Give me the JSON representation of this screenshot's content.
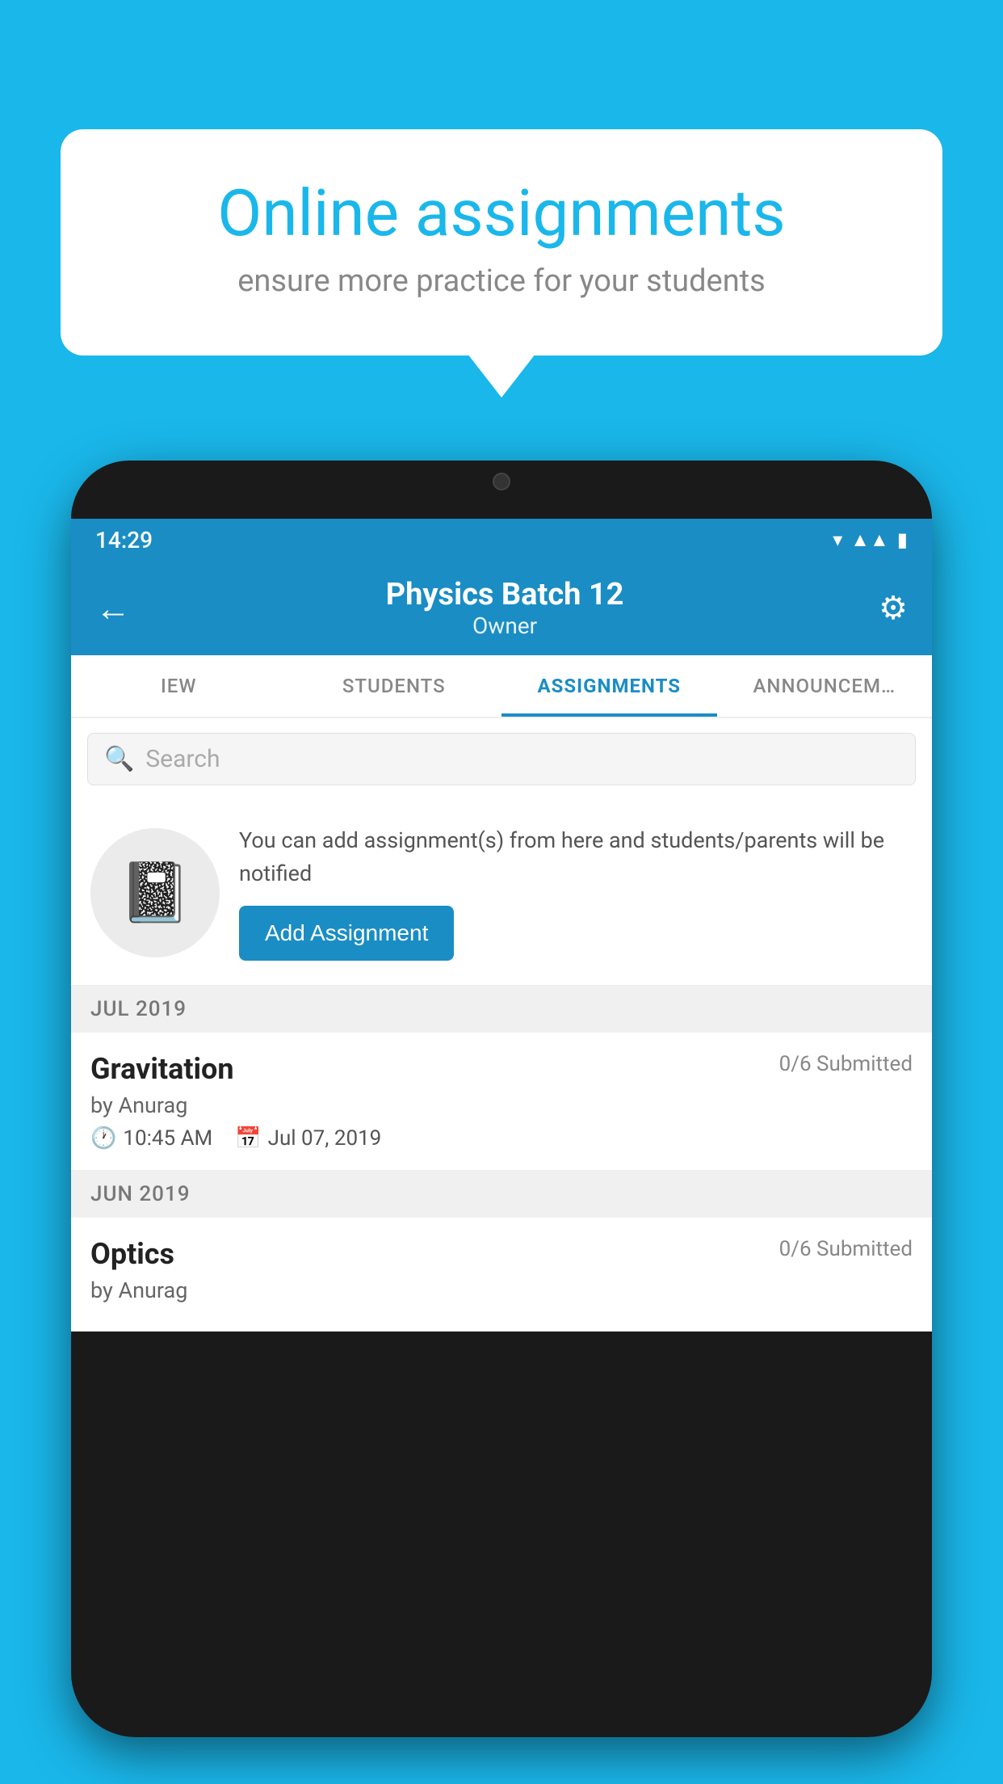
{
  "background_color": "#1ab7ea",
  "speech_bubble": {
    "title": "Online assignments",
    "subtitle": "ensure more practice for your students"
  },
  "phone": {
    "status_bar": {
      "time": "14:29",
      "icons": [
        "wifi",
        "signal",
        "battery"
      ]
    },
    "header": {
      "title": "Physics Batch 12",
      "subtitle": "Owner",
      "back_label": "←",
      "settings_label": "⚙"
    },
    "tabs": [
      {
        "label": "IEW",
        "active": false
      },
      {
        "label": "STUDENTS",
        "active": false
      },
      {
        "label": "ASSIGNMENTS",
        "active": true
      },
      {
        "label": "ANNOUNCEMENTS",
        "active": false
      }
    ],
    "search": {
      "placeholder": "Search"
    },
    "promo": {
      "text": "You can add assignment(s) from here and students/parents will be notified",
      "button_label": "Add Assignment"
    },
    "sections": [
      {
        "header": "JUL 2019",
        "assignments": [
          {
            "name": "Gravitation",
            "submitted": "0/6 Submitted",
            "by": "by Anurag",
            "time": "10:45 AM",
            "date": "Jul 07, 2019"
          }
        ]
      },
      {
        "header": "JUN 2019",
        "assignments": [
          {
            "name": "Optics",
            "submitted": "0/6 Submitted",
            "by": "by Anurag",
            "time": "",
            "date": ""
          }
        ]
      }
    ]
  }
}
